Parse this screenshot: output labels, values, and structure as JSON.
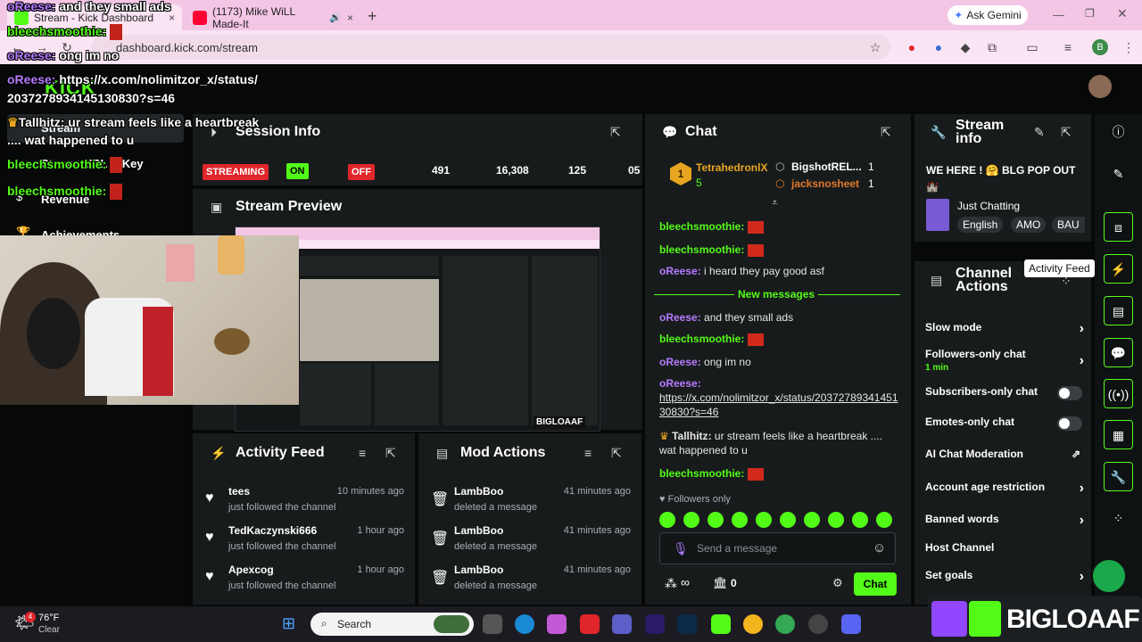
{
  "browser": {
    "tabs": [
      {
        "title": "Stream - Kick Dashboard",
        "close": "×"
      },
      {
        "title": "(1173) Mike WiLL Made-It",
        "close": "×"
      }
    ],
    "new_tab": "+",
    "ask_gemini": "Ask Gemini",
    "url": "dashboard.kick.com/stream",
    "profile_initial": "B"
  },
  "dashboard": {
    "logo": "KICK",
    "nav": [
      "Stream",
      "Stream URL & Key",
      "Revenue",
      "Achievements"
    ]
  },
  "session_info": {
    "title": "Session Info",
    "streaming_label": "STREAMING",
    "on_label": "ON",
    "off_label": "OFF",
    "stats": [
      "491",
      "16,308",
      "125",
      "05"
    ]
  },
  "stream_preview": {
    "title": "Stream Preview",
    "watermark": "BIGLOAAF"
  },
  "activity_feed": {
    "title": "Activity Feed",
    "items": [
      {
        "name": "tees",
        "sub": "just followed the channel",
        "time": "10 minutes ago"
      },
      {
        "name": "TedKaczynski666",
        "sub": "just followed the channel",
        "time": "1 hour ago"
      },
      {
        "name": "Apexcog",
        "sub": "just followed the channel",
        "time": "1 hour ago"
      }
    ]
  },
  "mod_actions": {
    "title": "Mod Actions",
    "items": [
      {
        "name": "LambBoo",
        "sub": "deleted a message",
        "time": "41 minutes ago"
      },
      {
        "name": "LambBoo",
        "sub": "deleted a message",
        "time": "41 minutes ago"
      },
      {
        "name": "LambBoo",
        "sub": "deleted a message",
        "time": "41 minutes ago"
      }
    ]
  },
  "chat": {
    "title": "Chat",
    "leaderboard": {
      "top": {
        "rank": "1",
        "name": "TetrahedronlX",
        "count": "5"
      },
      "others": [
        {
          "name": "BigshotREL...",
          "count": "1"
        },
        {
          "name": "jacksnosheet",
          "count": "1"
        }
      ]
    },
    "messages": [
      {
        "user": "bleechsmoothie",
        "text": ""
      },
      {
        "user": "bleechsmoothie",
        "text": ""
      },
      {
        "user": "oReese",
        "text": "i heard they pay good asf"
      }
    ],
    "new_messages_label": "New messages",
    "messages_new": [
      {
        "user": "oReese",
        "text": "and they small ads"
      },
      {
        "user": "bleechsmoothie",
        "text": ""
      },
      {
        "user": "oReese",
        "text": "ong im no"
      },
      {
        "user": "oReese",
        "text": "https://x.com/nolimitzor_x/status/2037278934145130830?s=46"
      },
      {
        "user": "Tallhitz",
        "text": "ur stream feels like a heartbreak .... wat happened to u"
      },
      {
        "user": "bleechsmoothie",
        "text": ""
      }
    ],
    "mode_label": "Followers only",
    "input_placeholder": "Send a message",
    "points": "0",
    "send_button": "Chat"
  },
  "stream_info": {
    "title": "Stream info",
    "stream_title": "WE HERE ! 🤗 BLG POP OUT",
    "category": "Just Chatting",
    "tags": [
      "English",
      "AMO",
      "BAU"
    ]
  },
  "channel_actions": {
    "title": "Channel Actions",
    "tooltip": "Activity Feed",
    "items": [
      {
        "label": "Slow mode",
        "control": "chevron",
        "sub": ""
      },
      {
        "label": "Followers-only chat",
        "control": "chevron",
        "sub": "1 min"
      },
      {
        "label": "Subscribers-only chat",
        "control": "toggle",
        "sub": ""
      },
      {
        "label": "Emotes-only chat",
        "control": "toggle",
        "sub": ""
      },
      {
        "label": "AI Chat Moderation",
        "control": "external",
        "sub": ""
      },
      {
        "label": "Account age restriction",
        "control": "chevron",
        "sub": ""
      },
      {
        "label": "Banned words",
        "control": "chevron",
        "sub": ""
      },
      {
        "label": "Host Channel",
        "control": "none",
        "sub": ""
      },
      {
        "label": "Set goals",
        "control": "chevron",
        "sub": ""
      }
    ]
  },
  "overlay": {
    "lines": [
      {
        "user": "oReese:",
        "text": "and they small ads"
      },
      {
        "user": "bleechsmoothie:",
        "text": ""
      },
      {
        "user": "oReese:",
        "text": "ong im no"
      },
      {
        "user": "oReese:",
        "text": "https://x.com/nolimitzor_x/status/"
      },
      {
        "user": "",
        "text": "2037278934145130830?s=46"
      },
      {
        "user": "Tallhitz:",
        "text": "ur stream feels like a heartbreak"
      },
      {
        "user": "",
        "text": ".... wat happened to u"
      },
      {
        "user": "bleechsmoothie:",
        "text": ""
      },
      {
        "user": "bleechsmoothie:",
        "text": ""
      }
    ],
    "brand": "BIGLOAAF"
  },
  "taskbar": {
    "weather_temp": "76°F",
    "weather_desc": "Clear",
    "weather_badge": "4",
    "search_label": "Search"
  },
  "colors": {
    "kick_green": "#53fc18",
    "username_purple": "#b57bff",
    "streaming_red": "#e0262b",
    "panel": "#181b1c"
  }
}
